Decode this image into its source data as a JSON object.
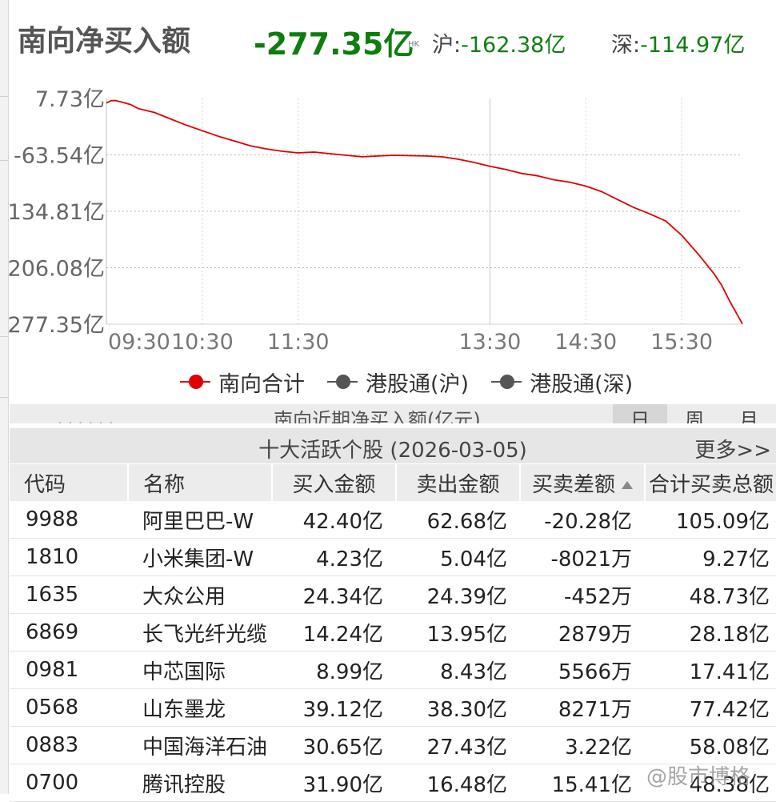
{
  "header": {
    "title": "南向净买入额",
    "total": "-277.35亿",
    "hk_tag": "HK",
    "sh_label": "沪:",
    "sh_value": "-162.38亿",
    "sz_label": "深:",
    "sz_value": "-114.97亿"
  },
  "chart_data": {
    "type": "line",
    "y_ticks": [
      "7.73亿",
      "-63.54亿",
      "134.81亿",
      "206.08亿",
      "277.35亿"
    ],
    "x_ticks": [
      "09:30",
      "10:30",
      "11:30",
      "13:30",
      "14:30",
      "15:30"
    ],
    "ylim": [
      -277.35,
      7.73
    ],
    "grid": true,
    "series": [
      {
        "name": "南向合计",
        "color": "#e00000",
        "points": [
          [
            "09:30",
            2
          ],
          [
            "09:33",
            5
          ],
          [
            "09:36",
            5
          ],
          [
            "09:40",
            3
          ],
          [
            "09:45",
            0
          ],
          [
            "09:50",
            -5
          ],
          [
            "10:00",
            -10
          ],
          [
            "10:10",
            -18
          ],
          [
            "10:20",
            -26
          ],
          [
            "10:30",
            -33
          ],
          [
            "10:40",
            -40
          ],
          [
            "10:50",
            -46
          ],
          [
            "11:00",
            -52
          ],
          [
            "11:10",
            -56
          ],
          [
            "11:20",
            -59
          ],
          [
            "11:30",
            -61
          ],
          [
            "11:40",
            -60
          ],
          [
            "11:50",
            -62
          ],
          [
            "12:00",
            -64
          ],
          [
            "12:10",
            -66
          ],
          [
            "12:20",
            -65
          ],
          [
            "12:30",
            -64
          ],
          [
            "12:50",
            -65
          ],
          [
            "13:00",
            -66
          ],
          [
            "13:10",
            -69
          ],
          [
            "13:20",
            -73
          ],
          [
            "13:30",
            -78
          ],
          [
            "13:40",
            -82
          ],
          [
            "13:50",
            -87
          ],
          [
            "14:00",
            -90
          ],
          [
            "14:10",
            -95
          ],
          [
            "14:20",
            -98
          ],
          [
            "14:30",
            -103
          ],
          [
            "14:40",
            -110
          ],
          [
            "14:50",
            -120
          ],
          [
            "15:00",
            -130
          ],
          [
            "15:10",
            -138
          ],
          [
            "15:20",
            -147
          ],
          [
            "15:30",
            -165
          ],
          [
            "15:40",
            -188
          ],
          [
            "15:50",
            -213
          ],
          [
            "15:55",
            -228
          ],
          [
            "16:00",
            -248
          ],
          [
            "16:05",
            -266
          ],
          [
            "16:08",
            -277
          ]
        ]
      },
      {
        "name": "港股通(沪)",
        "color": "#555555",
        "points": []
      },
      {
        "name": "港股通(深)",
        "color": "#555555",
        "points": []
      }
    ]
  },
  "legend": [
    "南向合计",
    "港股通(沪)",
    "港股通(深)"
  ],
  "recent_bar": {
    "title": "南向近期净买入额(亿元)",
    "tabs": [
      "日",
      "周",
      "月"
    ],
    "active_tab": "日"
  },
  "section": {
    "title": "十大活跃个股 (2026-03-05)",
    "more": "更多>>"
  },
  "table": {
    "headers": [
      "代码",
      "名称",
      "买入金额",
      "卖出金额",
      "买卖差额",
      "合计买卖总额"
    ],
    "rows": [
      {
        "code": "9988",
        "name": "阿里巴巴-W",
        "buy": "42.40亿",
        "sell": "62.68亿",
        "diff": "-20.28亿",
        "total": "105.09亿"
      },
      {
        "code": "1810",
        "name": "小米集团-W",
        "buy": "4.23亿",
        "sell": "5.04亿",
        "diff": "-8021万",
        "total": "9.27亿"
      },
      {
        "code": "1635",
        "name": "大众公用",
        "buy": "24.34亿",
        "sell": "24.39亿",
        "diff": "-452万",
        "total": "48.73亿"
      },
      {
        "code": "6869",
        "name": "长飞光纤光缆",
        "buy": "14.24亿",
        "sell": "13.95亿",
        "diff": "2879万",
        "total": "28.18亿"
      },
      {
        "code": "0981",
        "name": "中芯国际",
        "buy": "8.99亿",
        "sell": "8.43亿",
        "diff": "5566万",
        "total": "17.41亿"
      },
      {
        "code": "0568",
        "name": "山东墨龙",
        "buy": "39.12亿",
        "sell": "38.30亿",
        "diff": "8271万",
        "total": "77.42亿"
      },
      {
        "code": "0883",
        "name": "中国海洋石油",
        "buy": "30.65亿",
        "sell": "27.43亿",
        "diff": "3.22亿",
        "total": "58.08亿"
      },
      {
        "code": "0700",
        "name": "腾讯控股",
        "buy": "31.90亿",
        "sell": "16.48亿",
        "diff": "15.41亿",
        "total": "48.38亿"
      }
    ]
  },
  "watermark": "@股市博格"
}
